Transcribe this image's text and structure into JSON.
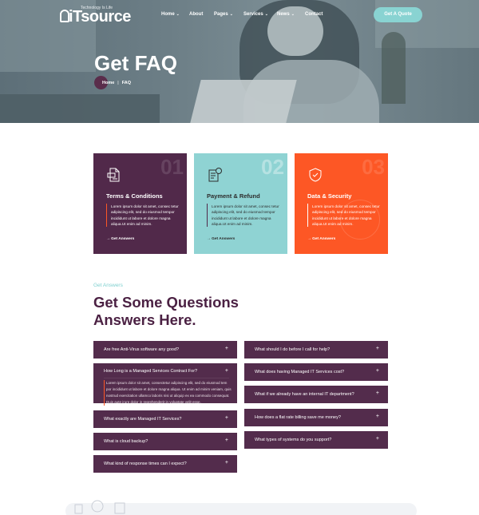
{
  "header": {
    "logo_text": "iTsource",
    "logo_tagline": "Technology Is Life",
    "nav": [
      {
        "label": "Home",
        "has_dropdown": true
      },
      {
        "label": "About",
        "has_dropdown": false
      },
      {
        "label": "Pages",
        "has_dropdown": true
      },
      {
        "label": "Services",
        "has_dropdown": true
      },
      {
        "label": "News",
        "has_dropdown": true
      },
      {
        "label": "Contact",
        "has_dropdown": false
      }
    ],
    "cta_label": "Get A Quote"
  },
  "hero": {
    "title": "Get FAQ",
    "breadcrumb": [
      {
        "label": "Home"
      },
      {
        "label": "FAQ"
      }
    ],
    "breadcrumb_separator": "|"
  },
  "cards": [
    {
      "number": "01",
      "title": "Terms & Conditions",
      "body": "Lorem ipsum dolor sit amet, consec tetur adipiscing elit, sed do eiusmod tempor incididunt ut labore et dolore magna aliqua.Ut enim ad minim.",
      "link": "Get Answers",
      "bg": "#51294a"
    },
    {
      "number": "02",
      "title": "Payment & Refund",
      "body": "Lorem ipsum dolor sit amet, consec tetur adipiscing elit, sed do eiusmod tempor incididunt ut labore et dolore magna aliqua.Ut enim ad minim.",
      "link": "Get Answers",
      "bg": "#8fd3d3"
    },
    {
      "number": "03",
      "title": "Data & Security",
      "body": "Lorem ipsum dolor sit amet, consec tetur adipiscing elit, sed do eiusmod tempor incididunt ut labore et dolore magna aliqua.Ut enim ad minim.",
      "link": "Get Answers",
      "bg": "#fd5725"
    }
  ],
  "faq": {
    "eyebrow": "Get Answers",
    "title_line1": "Get Some Questions",
    "title_line2": "Answers Here.",
    "left": [
      {
        "q": "Are free Anti-Virus software any good?",
        "open": false
      },
      {
        "q": "How Long is a Managed Services Contract For?",
        "open": true,
        "a": "Lorem ipsum dolor sit amet, consectetur adipiscing elit, sed do eiusmod tem por incididunt ut labore et dolore magna aliqua. Ut enim ad minim veniam, quis nostrud exercitation ullamco laboris nisi ut aliquip ex ea commodo consequat. Duis aute irure dolor in reprehenderit in voluptate velit esse."
      },
      {
        "q": "What exactly are Managed IT Services?",
        "open": false
      },
      {
        "q": "What is cloud backup?",
        "open": false
      },
      {
        "q": "What kind of response times can I expect?",
        "open": false
      }
    ],
    "right": [
      {
        "q": "What should I do before I call for help?",
        "open": false
      },
      {
        "q": "What does having Managed IT Services cost?",
        "open": false
      },
      {
        "q": "What if we already have an internal IT department?",
        "open": false
      },
      {
        "q": "How does a flat rate billing save me money?",
        "open": false
      },
      {
        "q": "What types of systems do you support?",
        "open": false
      }
    ],
    "toggle_symbol": "+"
  },
  "colors": {
    "purple": "#51294a",
    "teal": "#8fd3d3",
    "orange": "#fd5725",
    "heading": "#4b2143"
  }
}
